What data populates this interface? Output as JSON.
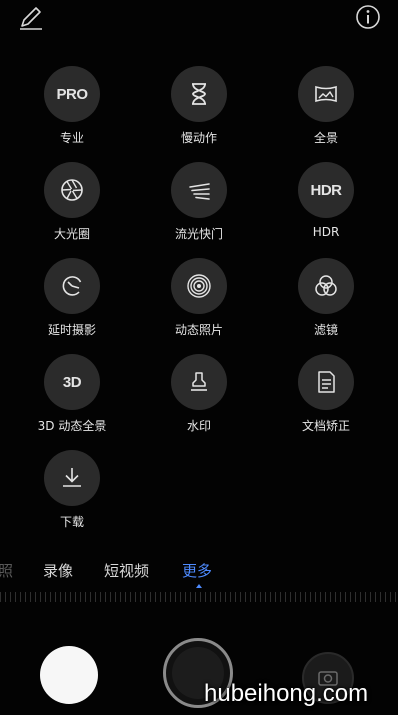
{
  "top_bar": {
    "edit_icon": "pencil-icon",
    "info_icon": "info-icon"
  },
  "modes": [
    {
      "label": "专业",
      "icon": "pro-icon",
      "glyph": "PRO"
    },
    {
      "label": "慢动作",
      "icon": "hourglass-icon"
    },
    {
      "label": "全景",
      "icon": "panorama-icon"
    },
    {
      "label": "大光圈",
      "icon": "aperture-icon"
    },
    {
      "label": "流光快门",
      "icon": "light-trail-icon"
    },
    {
      "label": "HDR",
      "icon": "hdr-icon",
      "glyph": "HDR"
    },
    {
      "label": "延时摄影",
      "icon": "timelapse-icon"
    },
    {
      "label": "动态照片",
      "icon": "moving-picture-icon"
    },
    {
      "label": "滤镜",
      "icon": "filter-icon"
    },
    {
      "label": "3D 动态全景",
      "icon": "3d-panorama-icon",
      "glyph": "3D"
    },
    {
      "label": "水印",
      "icon": "stamp-icon"
    },
    {
      "label": "文档矫正",
      "icon": "document-icon"
    },
    {
      "label": "下载",
      "icon": "download-icon"
    }
  ],
  "tabs": [
    {
      "label": "照",
      "state": "partial"
    },
    {
      "label": "录像",
      "state": "normal"
    },
    {
      "label": "短视频",
      "state": "normal"
    },
    {
      "label": "更多",
      "state": "active"
    }
  ],
  "colors": {
    "active_tab": "#4e8bff",
    "mode_circle": "#2b2b2b",
    "background": "#030303"
  },
  "watermark": "hubeihong.com"
}
